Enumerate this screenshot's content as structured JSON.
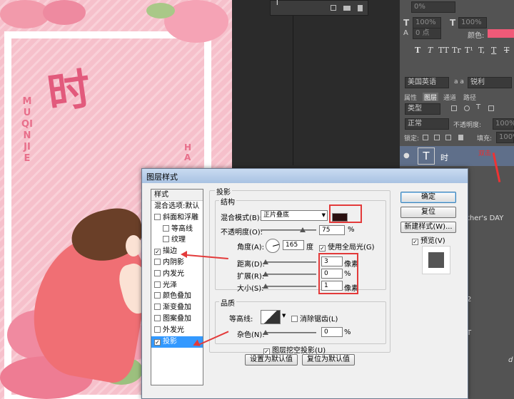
{
  "poster": {
    "big_character": "时",
    "vertical_text_left": "MU QIN JIE",
    "vertical_text_right": "HA",
    "colors": {
      "background": "#f7b9c5",
      "accent": "#e25a7c"
    }
  },
  "photoshop": {
    "layer_bar": {
      "label": "T"
    },
    "character_panel": {
      "tracking_value": "0%",
      "size_1": "100%",
      "size_2": "100%",
      "baseline": "0 点",
      "color_label": "颜色:",
      "color_swatch": "#f05a78",
      "format_buttons": [
        "T",
        "T",
        "TT",
        "Tr",
        "T¹",
        "T,",
        "T",
        "T"
      ],
      "language": "美国英语",
      "aa_label": "a a",
      "aa_method": "锐利"
    },
    "tabs": [
      "属性",
      "图层",
      "通道",
      "路径"
    ],
    "active_tab": "图层",
    "layers_panel": {
      "filter_kind": "类型",
      "blend_mode": "正常",
      "opacity_label": "不透明度:",
      "opacity": "100%",
      "lock_label": "锁定:",
      "fill_label": "填充:",
      "fill": "100%",
      "layer": {
        "thumb": "T",
        "name": "时",
        "note": "双击"
      }
    },
    "list_texts": [
      "ther's DAY",
      "2",
      "T",
      "d"
    ]
  },
  "dialog": {
    "title": "图层样式",
    "styles_header": "样式",
    "style_items": [
      {
        "label": "混合选项:默认",
        "checkbox": false,
        "checked": false,
        "indent": 0
      },
      {
        "label": "斜面和浮雕",
        "checkbox": true,
        "checked": false,
        "indent": 0
      },
      {
        "label": "等高线",
        "checkbox": true,
        "checked": false,
        "indent": 1
      },
      {
        "label": "纹理",
        "checkbox": true,
        "checked": false,
        "indent": 1
      },
      {
        "label": "描边",
        "checkbox": true,
        "checked": true,
        "indent": 0
      },
      {
        "label": "内阴影",
        "checkbox": true,
        "checked": false,
        "indent": 0
      },
      {
        "label": "内发光",
        "checkbox": true,
        "checked": false,
        "indent": 0
      },
      {
        "label": "光泽",
        "checkbox": true,
        "checked": false,
        "indent": 0
      },
      {
        "label": "颜色叠加",
        "checkbox": true,
        "checked": false,
        "indent": 0
      },
      {
        "label": "渐变叠加",
        "checkbox": true,
        "checked": false,
        "indent": 0
      },
      {
        "label": "图案叠加",
        "checkbox": true,
        "checked": false,
        "indent": 0
      },
      {
        "label": "外发光",
        "checkbox": true,
        "checked": false,
        "indent": 0
      },
      {
        "label": "投影",
        "checkbox": true,
        "checked": true,
        "indent": 0,
        "selected": true
      }
    ],
    "section_title": "投影",
    "structure": {
      "legend": "结构",
      "blend_mode_label": "混合模式(B):",
      "blend_mode_value": "正片叠底",
      "shadow_color": "#2a1010",
      "opacity_label": "不透明度(O):",
      "opacity_value": "75",
      "opacity_unit": "%",
      "angle_label": "角度(A):",
      "angle_value": "165",
      "angle_unit": "度",
      "global_light_label": "使用全局光(G)",
      "global_light_checked": true,
      "distance_label": "距离(D):",
      "distance_value": "3",
      "distance_unit": "像素",
      "spread_label": "扩展(R):",
      "spread_value": "0",
      "spread_unit": "%",
      "size_label": "大小(S):",
      "size_value": "1",
      "size_unit": "像素"
    },
    "quality": {
      "legend": "品质",
      "contour_label": "等高线:",
      "antialias_label": "消除锯齿(L)",
      "antialias_checked": false,
      "noise_label": "杂色(N):",
      "noise_value": "0",
      "noise_unit": "%"
    },
    "layer_knockout_label": "图层挖空投影(U)",
    "layer_knockout_checked": true,
    "make_default_label": "设置为默认值",
    "reset_default_label": "复位为默认值",
    "ok_label": "确定",
    "reset_label": "复位",
    "new_style_label": "新建样式(W)...",
    "preview_label": "预览(V)",
    "preview_checked": true
  }
}
